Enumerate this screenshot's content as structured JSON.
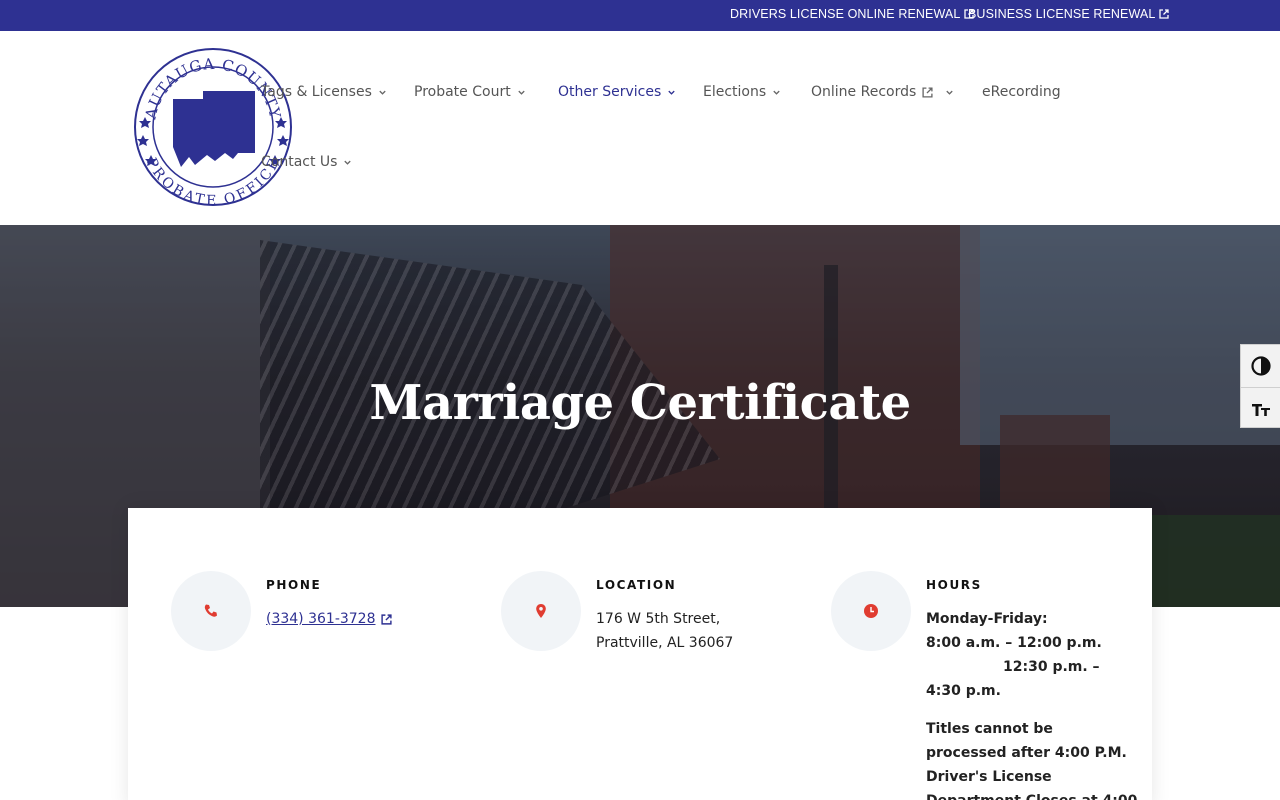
{
  "topbar": {
    "links": [
      {
        "label": "DRIVERS LICENSE ONLINE RENEWAL"
      },
      {
        "label": "BUSINESS LICENSE RENEWAL"
      }
    ]
  },
  "logo": {
    "top_text": "AUTAUGA COUNTY",
    "bottom_text": "PROBATE OFFICE"
  },
  "nav": {
    "items": [
      {
        "label": "Tags & Licenses"
      },
      {
        "label": "Probate Court"
      },
      {
        "label": "Other Services"
      },
      {
        "label": "Elections"
      },
      {
        "label": "Online Records"
      },
      {
        "label": "eRecording"
      },
      {
        "label": "Contact Us"
      }
    ],
    "active": "Other Services"
  },
  "hero": {
    "title": "Marriage Certificate"
  },
  "contact": {
    "phone": {
      "label": "PHONE",
      "value": "(334) 361-3728"
    },
    "location": {
      "label": "LOCATION",
      "line1": "176 W 5th Street,",
      "line2": "Prattville, AL 36067"
    },
    "hours": {
      "label": "HOURS",
      "line1": "Monday-Friday:",
      "line2": "8:00 a.m. – 12:00 p.m.",
      "line3": "12:30 p.m. –",
      "line4": "4:30 p.m.",
      "note1": "Titles cannot be",
      "note2": "processed after 4:00 P.M.",
      "note3": "Driver's License",
      "note4": "Department Closes at 4:00"
    }
  },
  "colors": {
    "brand": "#2e3192",
    "accent_icon": "#e03c31"
  },
  "icons": {
    "external": "external-link-icon",
    "chevron": "chevron-down-icon",
    "phone": "phone-icon",
    "location": "map-pin-icon",
    "hours": "clock-icon",
    "contrast": "contrast-icon",
    "font_size": "font-size-icon"
  }
}
